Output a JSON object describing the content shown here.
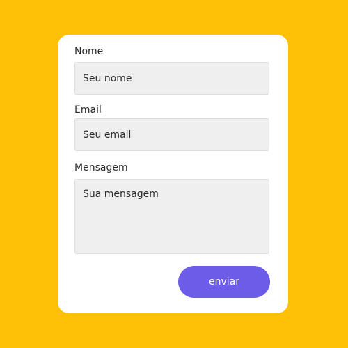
{
  "form": {
    "name_label": "Nome",
    "name_placeholder": "Seu nome",
    "email_label": "Email",
    "email_placeholder": "Seu email",
    "message_label": "Mensagem",
    "message_placeholder": "Sua mensagem",
    "submit_label": "enviar"
  },
  "colors": {
    "background": "#FFC107",
    "card": "#FFFFFF",
    "field": "#EFEFEF",
    "button": "#6C5CE7"
  }
}
